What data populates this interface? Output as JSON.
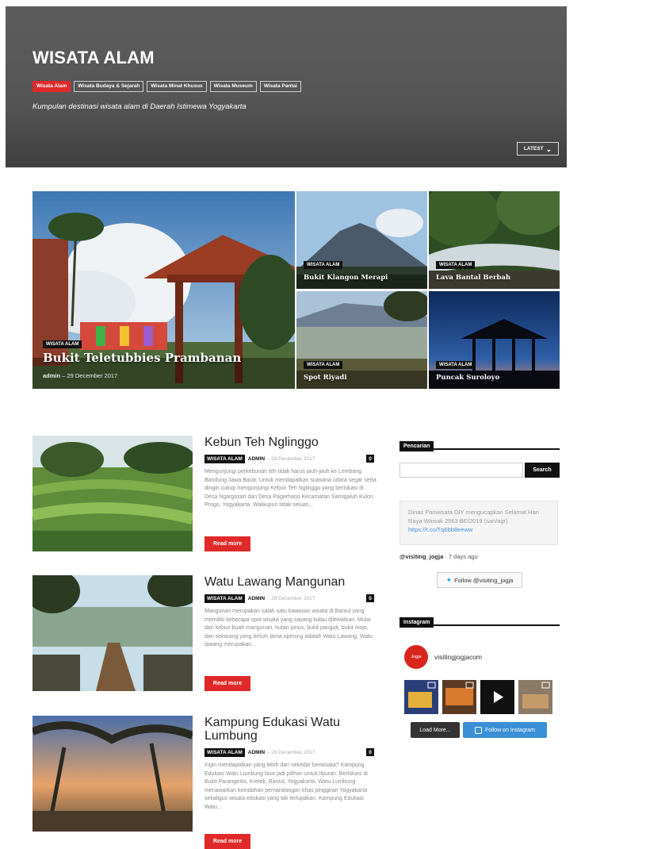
{
  "header": {
    "title": "WISATA ALAM",
    "subnav": [
      "Wisata Alam",
      "Wisata Budaya & Sejarah",
      "Wisata Minat Khusus",
      "Wisata Museum",
      "Wisata Pantai"
    ],
    "description": "Kumpulan destinasi wisata alam di Daerah Istimewa Yogyakarta",
    "sort_label": "LATEST"
  },
  "featured": [
    {
      "category": "WISATA ALAM",
      "title": "Bukit Teletubbies Prambanan",
      "author": "admin",
      "date": "29 December 2017"
    },
    {
      "category": "WISATA ALAM",
      "title": "Bukit Klangon Merapi"
    },
    {
      "category": "WISATA ALAM",
      "title": "Lava Bantal Berbah"
    },
    {
      "category": "WISATA ALAM",
      "title": "Spot Riyadi"
    },
    {
      "category": "WISATA ALAM",
      "title": "Puncak Suroloyo"
    }
  ],
  "posts": [
    {
      "title": "Kebun Teh Nglinggo",
      "category": "WISATA ALAM",
      "author": "ADMIN",
      "date": "28 December 2017",
      "comments": "0",
      "excerpt": "Mengunjungi perkebunan teh tidak harus jauh-jauh ke Lembang Bandung Jawa Barat. Untuk mendapatkan suasana udara segar serta dingin cukup mengunjungi Kebun Teh Nglinggo yang berlokasi di Desa Ngargosari dan Desa Pagerharjo Kecamatan Samigaluh Kulon Progo, Yogyakarta. Walaupun tidak seluas...",
      "read_more": "Read more"
    },
    {
      "title": "Watu Lawang Mangunan",
      "category": "WISATA ALAM",
      "author": "ADMIN",
      "date": "28 December 2017",
      "comments": "0",
      "excerpt": "Mangunan merupakan salah satu kawasan wisata di Bantul yang memiliki beberapa spot wisata yang sayang kalau dilewatkan. Mulai dari kebun buah mangunan, hutan pinus, bukit panguk, bukit mojo, dan sekarang yang belum lama opening adalah Watu Lawang. Watu lawang merupakan...",
      "read_more": "Read more"
    },
    {
      "title": "Kampung Edukasi Watu Lumbung",
      "category": "WISATA ALAM",
      "author": "ADMIN",
      "date": "28 December 2017",
      "comments": "0",
      "excerpt": "Ingin mendapatkan yang lebih dari sekedar berwisata? Kampung Edukasi Watu Lumbung bisa jadi pilihan untuk liburan. Berlokasi di Bukit Parangtritis, Kretek, Bantul, Yogyakarta, Watu Lumbung menawarkan keindahan pemandangan khas pinggiran Yogyakarta sekaligus wisata edukasi yang tak terlupakan. Kampung Edukasi Watu...",
      "read_more": "Read more"
    }
  ],
  "sidebar": {
    "search_title": "Pencarian",
    "search_placeholder": "",
    "search_button": "Search",
    "tweet_text": "Dinas Pariwisata DIY mengucapkan Selamat Hari Raya Waisak 2563 BE/2019 (san/agr)",
    "tweet_link": "https://t.co/Tq6bb8eeww",
    "tweet_user": "@visiting_jogja",
    "tweet_time": "· 7 days ago",
    "follow_twitter": "Follow @visiting_jogja",
    "instagram_title": "Instagram",
    "instagram_user": "visitingjogjacom",
    "avatar_text": "Jogja",
    "load_more": "Load More...",
    "follow_instagram": "Follow on Instagram"
  }
}
